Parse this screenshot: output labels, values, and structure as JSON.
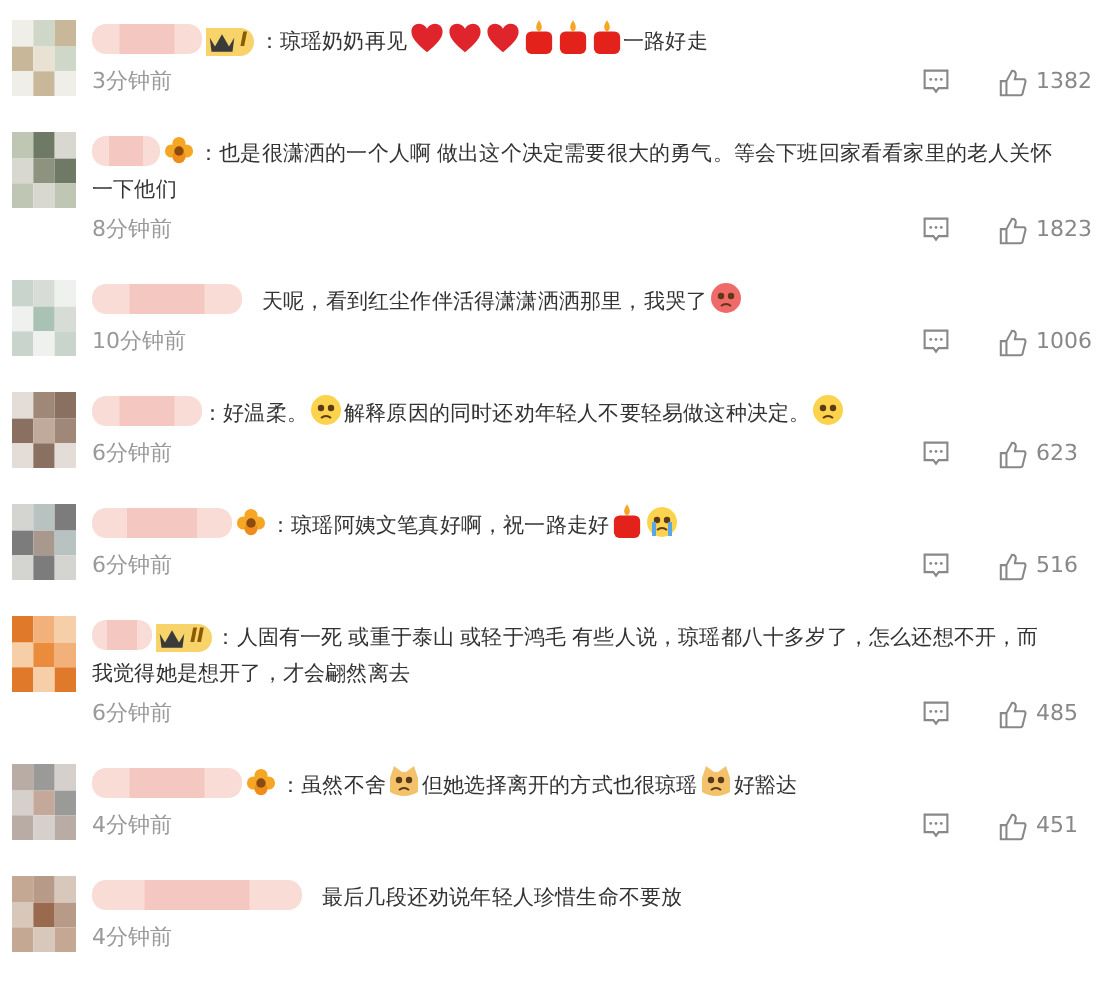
{
  "comments": [
    {
      "avatar": {
        "kind": "picture"
      },
      "badge": {
        "kind": "crown",
        "text": "I"
      },
      "colon": "：",
      "content": [
        {
          "kind": "text",
          "text": "琼瑶奶奶再见"
        },
        {
          "kind": "heart"
        },
        {
          "kind": "heart"
        },
        {
          "kind": "heart"
        },
        {
          "kind": "candle"
        },
        {
          "kind": "candle"
        },
        {
          "kind": "candle"
        },
        {
          "kind": "text",
          "text": "一路好走"
        }
      ],
      "time": "3分钟前",
      "likes": "1382"
    },
    {
      "avatar": {
        "kind": "picture"
      },
      "badge": {
        "kind": "flower"
      },
      "colon": "：",
      "content": [
        {
          "kind": "text",
          "text": "也是很潇洒的一个人啊 做出这个决定需要很大的勇气。等会下班回家看看家里的老人关怀"
        },
        {
          "kind": "text",
          "text": "一下他们"
        }
      ],
      "time": "8分钟前",
      "likes": "1823"
    },
    {
      "avatar": {
        "kind": "picture"
      },
      "content": [
        {
          "kind": "text",
          "text": "天呢，看到红尘作伴活得潇潇洒洒那里，我哭了"
        },
        {
          "kind": "angry-face"
        }
      ],
      "time": "10分钟前",
      "likes": "1006"
    },
    {
      "avatar": {
        "kind": "picture"
      },
      "colon": "：",
      "content": [
        {
          "kind": "text",
          "text": "好温柔。"
        },
        {
          "kind": "teary-face"
        },
        {
          "kind": "text",
          "text": "解释原因的同时还劝年轻人不要轻易做这种决定。"
        },
        {
          "kind": "teary-face"
        }
      ],
      "time": "6分钟前",
      "likes": "623"
    },
    {
      "avatar": {
        "kind": "picture"
      },
      "badge": {
        "kind": "flower"
      },
      "colon": "：",
      "content": [
        {
          "kind": "text",
          "text": "琼瑶阿姨文笔真好啊，祝一路走好"
        },
        {
          "kind": "candle"
        },
        {
          "kind": "sobbing-face"
        }
      ],
      "time": "6分钟前",
      "likes": "516"
    },
    {
      "avatar": {
        "kind": "picture"
      },
      "badge": {
        "kind": "crown",
        "text": "II"
      },
      "colon": "：",
      "content": [
        {
          "kind": "text",
          "text": "人固有一死 或重于泰山 或轻于鸿毛 有些人说，琼瑶都八十多岁了，怎么还想不开，而"
        },
        {
          "kind": "text",
          "text": "我觉得她是想开了，才会翩然离去"
        }
      ],
      "time": "6分钟前",
      "likes": "485"
    },
    {
      "avatar": {
        "kind": "picture"
      },
      "badge": {
        "kind": "flower"
      },
      "colon": "：",
      "content": [
        {
          "kind": "text",
          "text": "虽然不舍"
        },
        {
          "kind": "cat-face"
        },
        {
          "kind": "text",
          "text": "但她选择离开的方式也很琼瑶"
        },
        {
          "kind": "cat-face"
        },
        {
          "kind": "text",
          "text": "好豁达"
        }
      ],
      "time": "4分钟前",
      "likes": "451"
    },
    {
      "avatar": {
        "kind": "picture"
      },
      "content": [
        {
          "kind": "text",
          "text": "最后几段还劝说年轻人珍惜生命不要放"
        }
      ],
      "time": "4分钟前"
    }
  ]
}
